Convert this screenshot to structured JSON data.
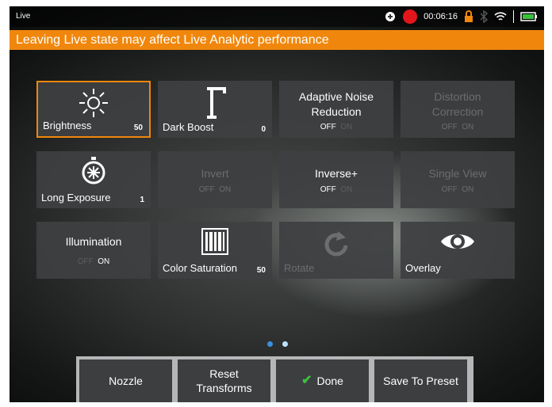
{
  "status": {
    "app": "Live",
    "time": "00:06:16"
  },
  "banner": {
    "text": "Leaving Live state may affect Live Analytic performance"
  },
  "tiles": {
    "brightness": {
      "label": "Brightness",
      "value": "50"
    },
    "dark_boost": {
      "label": "Dark Boost",
      "value": "0"
    },
    "adaptive_noise": {
      "title": "Adaptive Noise Reduction",
      "off": "OFF",
      "on": "ON"
    },
    "distortion": {
      "title": "Distortion Correction",
      "off": "OFF",
      "on": "ON"
    },
    "long_exposure": {
      "label": "Long Exposure",
      "value": "1"
    },
    "invert": {
      "title": "Invert",
      "off": "OFF",
      "on": "ON"
    },
    "inverse_plus": {
      "title": "Inverse+",
      "off": "OFF",
      "on": "ON"
    },
    "single_view": {
      "title": "Single View",
      "off": "OFF",
      "on": "ON"
    },
    "illumination": {
      "title": "Illumination",
      "off": "OFF",
      "on": "ON"
    },
    "color_saturation": {
      "label": "Color Saturation",
      "value": "50"
    },
    "rotate": {
      "label": "Rotate"
    },
    "overlay": {
      "label": "Overlay"
    }
  },
  "buttons": {
    "nozzle": "Nozzle",
    "reset": "Reset Transforms",
    "done": "Done",
    "save": "Save To Preset"
  },
  "colors": {
    "accent": "#f0870c",
    "record": "#e3161b",
    "check": "#3cc13b"
  }
}
